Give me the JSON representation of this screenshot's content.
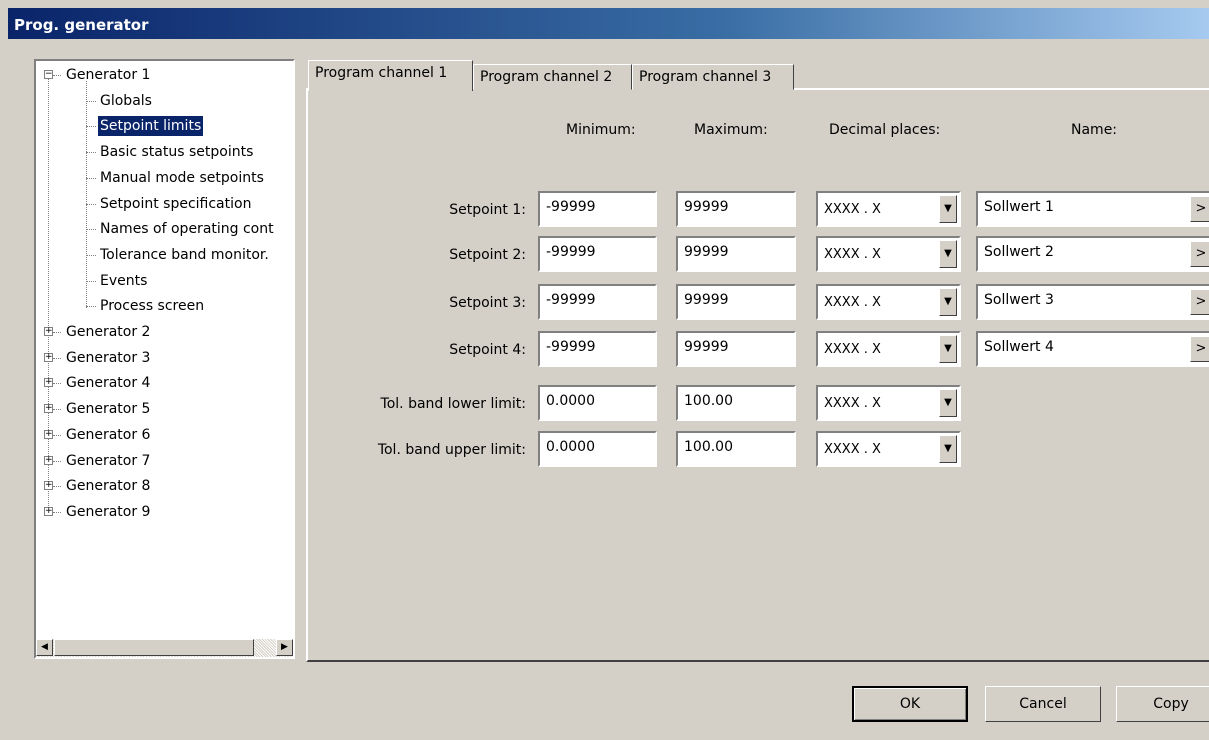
{
  "window": {
    "title": "Prog. generator"
  },
  "tree": {
    "expanded_label": "Generator 1",
    "children": [
      "Globals",
      "Setpoint limits",
      "Basic status setpoints",
      "Manual mode setpoints",
      "Setpoint specification",
      "Names of operating cont",
      "Tolerance band monitor.",
      "Events",
      "Process screen"
    ],
    "selected": "Setpoint limits",
    "collapsed": [
      "Generator 2",
      "Generator 3",
      "Generator 4",
      "Generator 5",
      "Generator 6",
      "Generator 7",
      "Generator 8",
      "Generator 9"
    ]
  },
  "tabs": [
    "Program channel 1",
    "Program channel 2",
    "Program channel 3"
  ],
  "columns": {
    "minimum": "Minimum:",
    "maximum": "Maximum:",
    "decimal": "Decimal places:",
    "name": "Name:"
  },
  "rows": [
    {
      "label": "Setpoint 1:",
      "min": "-99999",
      "max": "99999",
      "decimal": "XXXX . X",
      "name": "Sollwert 1"
    },
    {
      "label": "Setpoint 2:",
      "min": "-99999",
      "max": "99999",
      "decimal": "XXXX . X",
      "name": "Sollwert 2"
    },
    {
      "label": "Setpoint 3:",
      "min": "-99999",
      "max": "99999",
      "decimal": "XXXX . X",
      "name": "Sollwert 3"
    },
    {
      "label": "Setpoint 4:",
      "min": "-99999",
      "max": "99999",
      "decimal": "XXXX . X",
      "name": "Sollwert 4"
    },
    {
      "label": "Tol. band lower limit:",
      "min": "0.0000",
      "max": "100.00",
      "decimal": "XXXX . X"
    },
    {
      "label": "Tol. band upper limit:",
      "min": "0.0000",
      "max": "100.00",
      "decimal": "XXXX . X"
    }
  ],
  "more_button_label": ">",
  "buttons": {
    "ok": "OK",
    "cancel": "Cancel",
    "copy": "Copy"
  }
}
